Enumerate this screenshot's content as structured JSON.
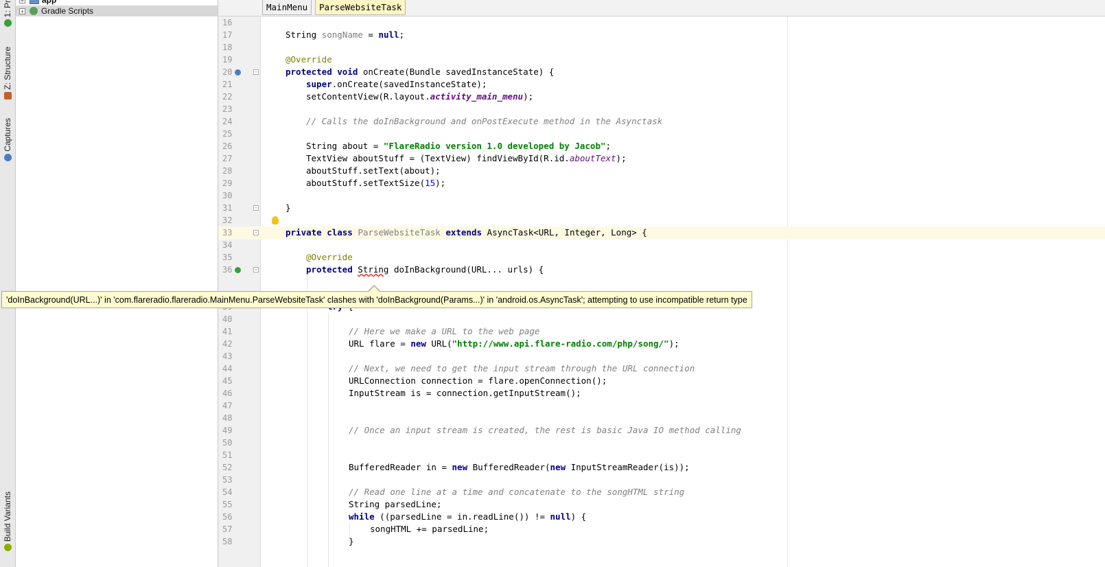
{
  "left_tabs": [
    {
      "label": "1: Pr",
      "icon": "project-icon",
      "color": "#3c9d3c"
    },
    {
      "label": "Z: Structure",
      "icon": "structure-icon",
      "color": "#c06030"
    },
    {
      "label": "Captures",
      "icon": "camera-icon",
      "color": "#4a7ebf"
    },
    {
      "label": "Build Variants",
      "icon": "android-icon",
      "color": "#8ab000"
    }
  ],
  "project_tree": [
    {
      "label": "app",
      "icon": "module-folder-icon",
      "selected": false
    },
    {
      "label": "Gradle Scripts",
      "icon": "gradle-icon",
      "selected": true
    }
  ],
  "editor_tabs": [
    {
      "label": "MainMenu",
      "active": false
    },
    {
      "label": "ParseWebsiteTask",
      "active": true
    }
  ],
  "code_lines": [
    {
      "n": "16",
      "text": ""
    },
    {
      "n": "17",
      "text": "String songName = null;"
    },
    {
      "n": "18",
      "text": ""
    },
    {
      "n": "19",
      "text": "@Override"
    },
    {
      "n": "20",
      "text": "protected void onCreate(Bundle savedInstanceState) {"
    },
    {
      "n": "21",
      "text": "super.onCreate(savedInstanceState);"
    },
    {
      "n": "22",
      "text": "setContentView(R.layout.activity_main_menu);"
    },
    {
      "n": "23",
      "text": ""
    },
    {
      "n": "24",
      "text": "// Calls the doInBackground and onPostExecute method in the Asynctask"
    },
    {
      "n": "25",
      "text": ""
    },
    {
      "n": "26",
      "text": "String about = \"FlareRadio version 1.0 developed by Jacob\";"
    },
    {
      "n": "27",
      "text": "TextView aboutStuff = (TextView) findViewById(R.id.aboutText);"
    },
    {
      "n": "28",
      "text": "aboutStuff.setText(about);"
    },
    {
      "n": "29",
      "text": "aboutStuff.setTextSize(15);"
    },
    {
      "n": "30",
      "text": ""
    },
    {
      "n": "31",
      "text": "}"
    },
    {
      "n": "32",
      "text": ""
    },
    {
      "n": "33",
      "text": "private class ParseWebsiteTask extends AsyncTask<URL, Integer, Long> {"
    },
    {
      "n": "34",
      "text": ""
    },
    {
      "n": "35",
      "text": "@Override"
    },
    {
      "n": "36",
      "text": "protected String doInBackground(URL... urls) {"
    },
    {
      "n": "39",
      "text": "try {"
    },
    {
      "n": "40",
      "text": ""
    },
    {
      "n": "41",
      "text": "// Here we make a URL to the web page"
    },
    {
      "n": "42",
      "text": "URL flare = new URL(\"http://www.api.flare-radio.com/php/song/\");"
    },
    {
      "n": "43",
      "text": ""
    },
    {
      "n": "44",
      "text": "// Next, we need to get the input stream through the URL connection"
    },
    {
      "n": "45",
      "text": "URLConnection connection = flare.openConnection();"
    },
    {
      "n": "46",
      "text": "InputStream is = connection.getInputStream();"
    },
    {
      "n": "47",
      "text": ""
    },
    {
      "n": "48",
      "text": ""
    },
    {
      "n": "49",
      "text": "// Once an input stream is created, the rest is basic Java IO method calling"
    },
    {
      "n": "50",
      "text": ""
    },
    {
      "n": "51",
      "text": ""
    },
    {
      "n": "52",
      "text": "BufferedReader in = new BufferedReader(new InputStreamReader(is));"
    },
    {
      "n": "53",
      "text": ""
    },
    {
      "n": "54",
      "text": "// Read one line at a time and concatenate to the songHTML string"
    },
    {
      "n": "55",
      "text": "String parsedLine;"
    },
    {
      "n": "56",
      "text": "while ((parsedLine = in.readLine()) != null) {"
    },
    {
      "n": "57",
      "text": "songHTML += parsedLine;"
    },
    {
      "n": "58",
      "text": "}"
    }
  ],
  "error_tooltip": "'doInBackground(URL...)' in 'com.flareradio.flareradio.MainMenu.ParseWebsiteTask' clashes with 'doInBackground(Params...)' in 'android.os.AsyncTask'; attempting to use incompatible return type",
  "colors": {
    "keyword": "#000080",
    "string": "#008000",
    "comment": "#808080",
    "annotation": "#808000",
    "field": "#660e7a",
    "number": "#0000ff",
    "tooltip_bg": "#fdfbcf",
    "caret_line": "#fdf9e3"
  }
}
